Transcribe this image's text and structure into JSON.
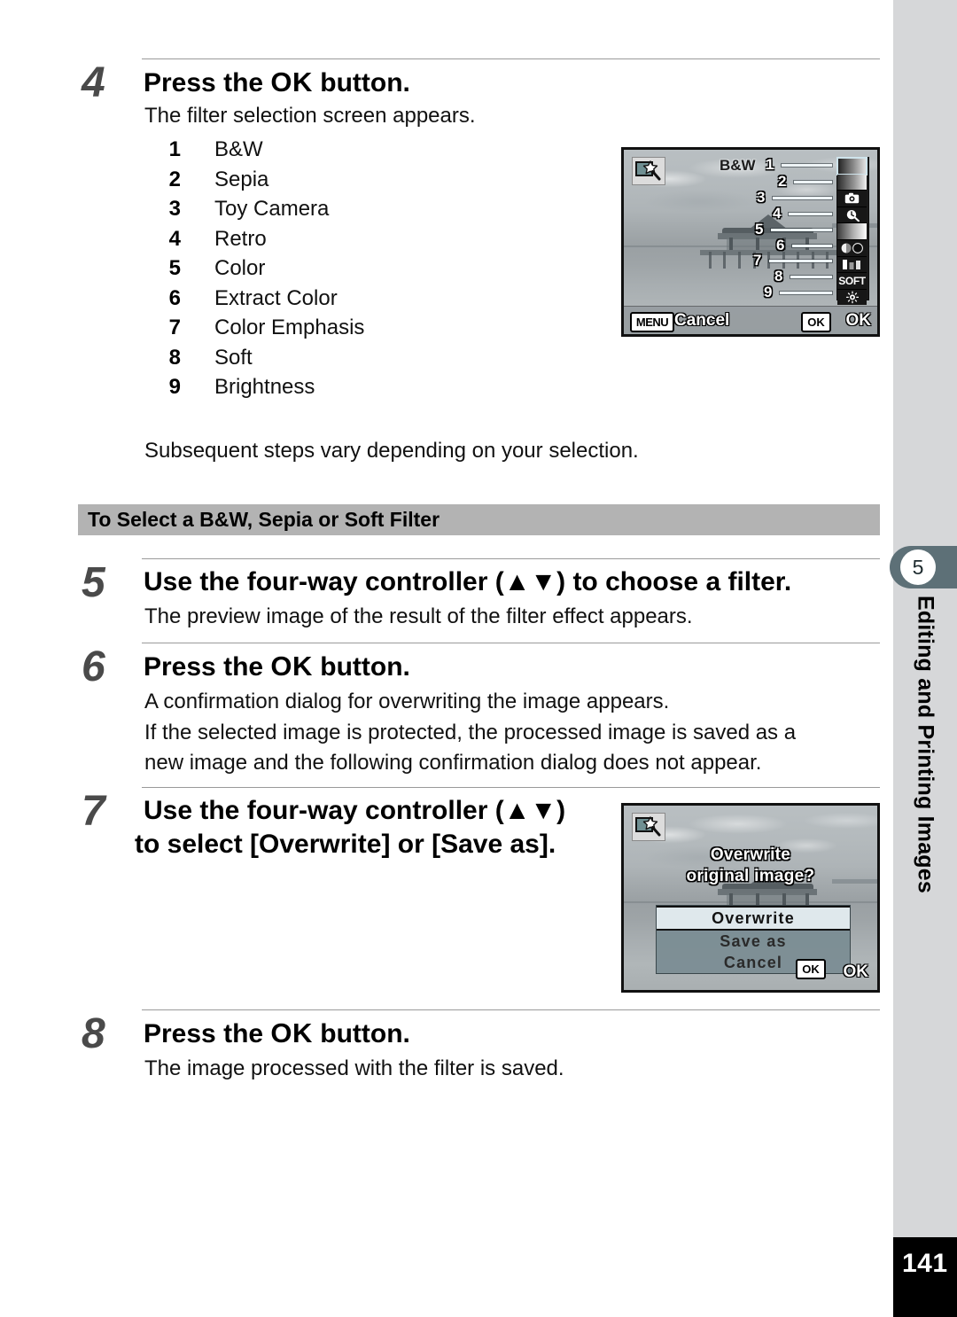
{
  "page": {
    "number": "141",
    "chapter_number": "5",
    "chapter_title": "Editing and Printing Images"
  },
  "steps": [
    {
      "number": "4",
      "heading_before": "Press the ",
      "heading_key": "OK",
      "heading_after": " button.",
      "body": "The filter selection screen appears."
    },
    {
      "number": "5",
      "heading": "Use the four-way controller (▲▼) to choose a filter.",
      "body": "The preview image of the result of the filter effect appears."
    },
    {
      "number": "6",
      "heading_before": "Press the ",
      "heading_key": "OK",
      "heading_after": " button.",
      "body1": "A confirmation dialog for overwriting the image appears.",
      "body2": "If the selected image is protected, the processed image is saved as a",
      "body3": "new image and the following confirmation dialog does not appear."
    },
    {
      "number": "7",
      "heading_line1": "Use the four-way controller (▲▼)",
      "heading_line2": "to select [Overwrite] or [Save as]."
    },
    {
      "number": "8",
      "heading_before": "Press the ",
      "heading_key": "OK",
      "heading_after": " button.",
      "body": "The image processed with the filter is saved."
    }
  ],
  "filter_list": [
    {
      "num": "1",
      "label": "B&W"
    },
    {
      "num": "2",
      "label": "Sepia"
    },
    {
      "num": "3",
      "label": "Toy Camera"
    },
    {
      "num": "4",
      "label": "Retro"
    },
    {
      "num": "5",
      "label": "Color"
    },
    {
      "num": "6",
      "label": "Extract Color"
    },
    {
      "num": "7",
      "label": "Color Emphasis"
    },
    {
      "num": "8",
      "label": "Soft"
    },
    {
      "num": "9",
      "label": "Brightness"
    }
  ],
  "note": "Subsequent steps vary depending on your selection.",
  "section_band": {
    "title": "To Select a B&W, Sepia or Soft Filter"
  },
  "lcd_filter_screen": {
    "mode_label": "B&W",
    "callouts": [
      "1",
      "2",
      "3",
      "4",
      "5",
      "6",
      "7",
      "8",
      "9"
    ],
    "soft_icon_text": "SOFT",
    "menu_key": "MENU",
    "menu_action": "Cancel",
    "ok_key": "OK",
    "ok_action": "OK"
  },
  "lcd_overwrite_screen": {
    "question_line1": "Overwrite",
    "question_line2": "original image?",
    "options": [
      "Overwrite",
      "Save as",
      "Cancel"
    ],
    "selected_option": "Overwrite",
    "ok_key": "OK",
    "ok_action": "OK"
  },
  "colors": {
    "band_gray": "#b3b3b3",
    "rail_gray": "#d6d7d9",
    "tab_slate": "#5d7077",
    "step_number_gray": "#4a4a4a",
    "footer_black": "#000000"
  }
}
